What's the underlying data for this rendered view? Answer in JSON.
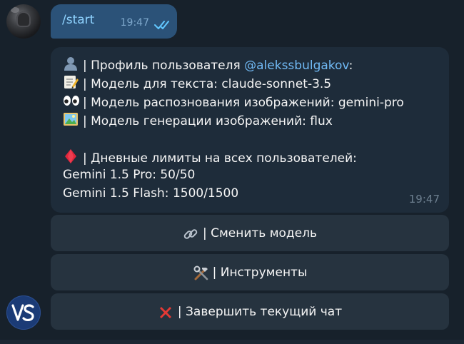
{
  "colors": {
    "background": "#17212b",
    "outgoing_bubble": "#2b5278",
    "incoming_bubble": "#1e2c3a",
    "keyboard_button": "#26333f",
    "link": "#71baf5",
    "command": "#8fd3ff",
    "read_check": "#62c8ff"
  },
  "outgoing_message": {
    "text": "/start",
    "time": "19:47",
    "status_icon": "double-check-icon"
  },
  "incoming_message": {
    "lines": {
      "profile_prefix": "| Профиль пользователя ",
      "profile_mention": "@alekssbulgakov",
      "profile_suffix": ":",
      "text_model": "| Модель для текста: claude-sonnet-3.5",
      "vision_model": "| Модель распознования изображений: gemini-pro",
      "image_model": "| Модель генерации изображений: flux",
      "limits_title": "| Дневные лимиты на всех пользователей:",
      "limit_pro": "Gemini 1.5 Pro: 50/50",
      "limit_flash": "Gemini 1.5 Flash: 1500/1500"
    },
    "icons": {
      "profile": "user-silhouette-icon",
      "text_model": "memo-icon",
      "vision_model": "eyes-icon",
      "image_model": "picture-icon",
      "limits": "red-diamond-icon"
    },
    "time": "19:47"
  },
  "keyboard": {
    "change_model": {
      "icon": "link-icon",
      "label": "| Сменить модель"
    },
    "tools": {
      "icon": "tools-icon",
      "label": "| Инструменты"
    },
    "end_chat": {
      "icon": "cross-mark-icon",
      "label": "| Завершить текущий чат"
    }
  },
  "bot": {
    "avatar_icon": "vs-logo-icon"
  }
}
